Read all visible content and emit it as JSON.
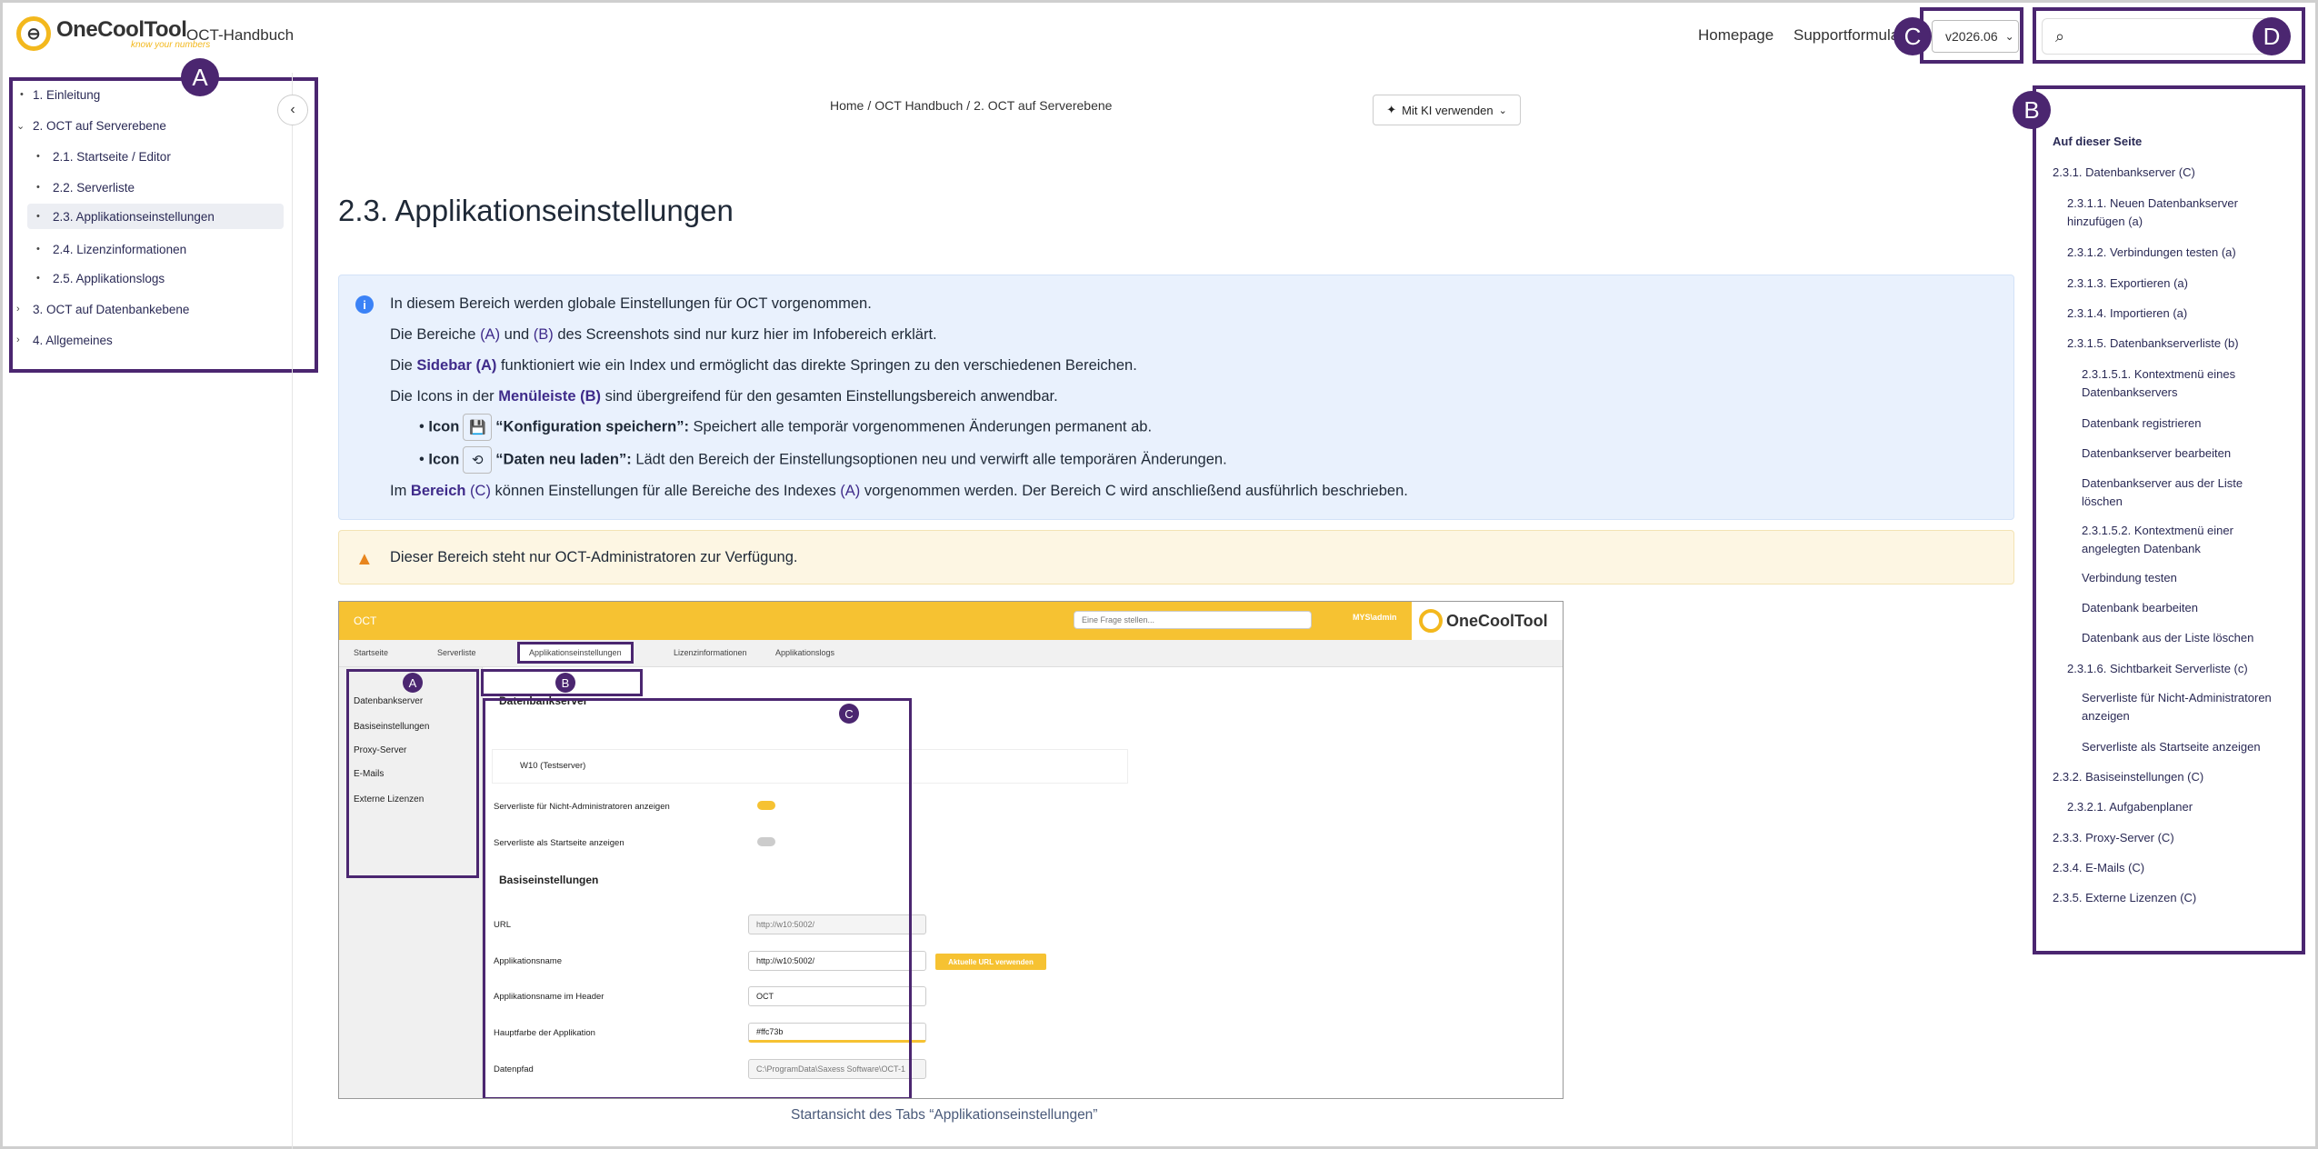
{
  "header": {
    "logo_name": "OneCoolTool",
    "logo_tagline": "know your numbers",
    "site_title": "OCT-Handbuch",
    "nav": [
      {
        "label": "Homepage"
      },
      {
        "label": "Supportformula"
      }
    ],
    "version": "v2026.06"
  },
  "badges": {
    "a": "A",
    "b": "B",
    "c": "C",
    "d": "D"
  },
  "sidebar": {
    "items": [
      {
        "mark": "•",
        "label": "1. Einleitung"
      },
      {
        "mark": "⌄",
        "label": "2. OCT auf Serverebene"
      },
      {
        "mark": "•",
        "label": "2.1. Startseite / Editor"
      },
      {
        "mark": "•",
        "label": "2.2. Serverliste"
      },
      {
        "mark": "•",
        "label": "2.3. Applikationseinstellungen"
      },
      {
        "mark": "•",
        "label": "2.4. Lizenzinformationen"
      },
      {
        "mark": "•",
        "label": "2.5. Applikationslogs"
      },
      {
        "mark": "›",
        "label": "3. OCT auf Datenbankebene"
      },
      {
        "mark": "›",
        "label": "4. Allgemeines"
      }
    ]
  },
  "breadcrumb": [
    "Home",
    "OCT Handbuch",
    "2. OCT auf Serverebene"
  ],
  "ki_button": "Mit KI verwenden",
  "page_title": "2.3. Applikationseinstellungen",
  "info": {
    "l1": "In diesem Bereich werden globale Einstellungen für OCT vorgenommen.",
    "l2a": "Die Bereiche ",
    "l2b": "(A)",
    "l2c": " und ",
    "l2d": "(B)",
    "l2e": " des Screenshots sind nur kurz hier im Infobereich erklärt.",
    "l3a": "Die ",
    "l3b": "Sidebar (A)",
    "l3c": " funktioniert wie ein Index und ermöglicht das direkte Springen zu den verschiedenen Bereichen.",
    "l4a": "Die Icons in der ",
    "l4b": "Menüleiste (B)",
    "l4c": " sind übergreifend für den gesamten Einstellungsbereich anwendbar.",
    "b1a": "Icon",
    "b1b": "“Konfiguration speichern”:",
    "b1c": " Speichert alle temporär vorgenommenen Änderungen permanent ab.",
    "b2a": "Icon",
    "b2b": "“Daten neu laden”:",
    "b2c": " Lädt den Bereich der Einstellungsoptionen neu und verwirft alle temporären Änderungen.",
    "l5a": "Im ",
    "l5b": "Bereich",
    "l5c": " (C)",
    "l5d": " können Einstellungen für alle Bereiche des Indexes ",
    "l5e": "(A)",
    "l5f": " vorgenommen werden. Der Bereich C wird anschließend ausführlich beschrieben."
  },
  "warning": "Dieser Bereich steht nur OCT-Administratoren zur Verfügung.",
  "screenshot": {
    "app_title": "OCT",
    "search_placeholder": "Eine Frage stellen...",
    "user": "MYS\\admin",
    "tabs": [
      "Startseite",
      "Serverliste",
      "Applikationseinstellungen",
      "Lizenzinformationen",
      "Applikationslogs"
    ],
    "side": [
      "Datenbankserver",
      "Basiseinstellungen",
      "Proxy-Server",
      "E-Mails",
      "Externe Lizenzen"
    ],
    "section1": "Datenbankserver",
    "server": "W10 (Testserver)",
    "opt1": "Serverliste für Nicht-Administratoren anzeigen",
    "opt2": "Serverliste als Startseite anzeigen",
    "section2": "Basiseinstellungen",
    "f_url": "URL",
    "f_url_val": "http://w10:5002/",
    "f_app": "Applikationsname",
    "f_app_val": "http://w10:5002/",
    "f_app_btn": "Aktuelle URL verwenden",
    "f_header": "Applikationsname im Header",
    "f_header_val": "OCT",
    "f_color": "Hauptfarbe der Applikation",
    "f_color_val": "#ffc73b",
    "f_path": "Datenpfad",
    "f_path_val": "C:\\ProgramData\\Saxess Software\\OCT-1"
  },
  "caption": "Startansicht des Tabs “Applikationseinstellungen”",
  "toc": {
    "title": "Auf dieser Seite",
    "items": [
      "2.3.1. Datenbankserver (C)",
      "2.3.1.1. Neuen Datenbankserver hinzufügen (a)",
      "2.3.1.2. Verbindungen testen (a)",
      "2.3.1.3. Exportieren (a)",
      "2.3.1.4. Importieren (a)",
      "2.3.1.5. Datenbankserverliste (b)",
      "2.3.1.5.1. Kontextmenü eines Datenbankservers",
      "Datenbank registrieren",
      "Datenbankserver bearbeiten",
      "Datenbankserver aus der Liste löschen",
      "2.3.1.5.2. Kontextmenü einer angelegten Datenbank",
      "Verbindung testen",
      "Datenbank bearbeiten",
      "Datenbank aus der Liste löschen",
      "2.3.1.6. Sichtbarkeit Serverliste (c)",
      "Serverliste für Nicht-Administratoren anzeigen",
      "Serverliste als Startseite anzeigen",
      "2.3.2. Basiseinstellungen (C)",
      "2.3.2.1. Aufgabenplaner",
      "2.3.3. Proxy-Server (C)",
      "2.3.4. E-Mails (C)",
      "2.3.5. Externe Lizenzen (C)"
    ]
  }
}
